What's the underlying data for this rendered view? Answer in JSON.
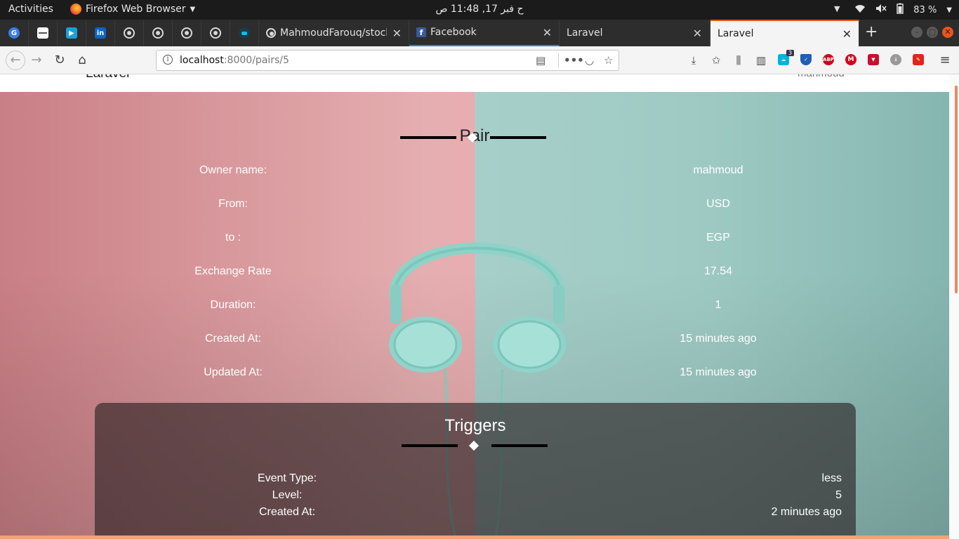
{
  "system_bar": {
    "activities": "Activities",
    "app_name": "Firefox Web Browser",
    "clock": "ح فبر 17, 11:48 ص",
    "battery": "83 %"
  },
  "tabs": {
    "pinned": [
      {
        "name": "google",
        "color": "#3b7bea"
      },
      {
        "name": "doc",
        "color": "#ffffff"
      },
      {
        "name": "media",
        "color": "#1aa1d6"
      },
      {
        "name": "linkedin",
        "color": "#0a66c2"
      },
      {
        "name": "github-1",
        "color": "#d8d8d8"
      },
      {
        "name": "github-2",
        "color": "#d8d8d8"
      },
      {
        "name": "github-3",
        "color": "#d8d8d8"
      },
      {
        "name": "github-4",
        "color": "#d8d8d8"
      },
      {
        "name": "app",
        "color": "#00a3cc"
      }
    ],
    "open": [
      {
        "title": "MahmoudFarouq/stock"
      },
      {
        "title": "Facebook"
      },
      {
        "title": "Laravel"
      },
      {
        "title": "Laravel"
      }
    ]
  },
  "navbar": {
    "url_host": "localhost",
    "url_rest": ":8000/pairs/5",
    "badge_count": "3"
  },
  "site": {
    "brand": "Laravel",
    "user": "mahmoud"
  },
  "pair": {
    "title": "Pair",
    "rows": [
      {
        "label": "Owner name:",
        "value": "mahmoud"
      },
      {
        "label": "From:",
        "value": "USD"
      },
      {
        "label": "to :",
        "value": "EGP"
      },
      {
        "label": "Exchange Rate",
        "value": "17.54"
      },
      {
        "label": "Duration:",
        "value": "1"
      },
      {
        "label": "Created At:",
        "value": "15 minutes ago"
      },
      {
        "label": "Updated At:",
        "value": "15 minutes ago"
      }
    ]
  },
  "triggers": {
    "title": "Triggers",
    "rows": [
      {
        "label": "Event Type:",
        "value": "less"
      },
      {
        "label": "Level:",
        "value": "5"
      },
      {
        "label": "Created At:",
        "value": "2 minutes ago"
      }
    ]
  }
}
